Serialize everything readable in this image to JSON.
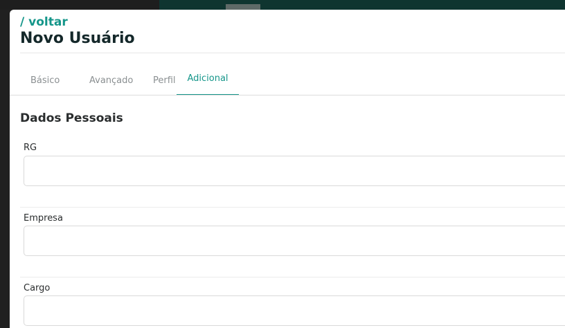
{
  "header": {
    "back_label": "/ voltar",
    "title": "Novo Usuário"
  },
  "tabs": [
    {
      "label": "Básico",
      "active": false
    },
    {
      "label": "Avançado",
      "active": false
    },
    {
      "label": "Perfil",
      "active": false
    },
    {
      "label": "Adicional",
      "active": true
    }
  ],
  "section": {
    "title": "Dados Pessoais"
  },
  "fields": [
    {
      "label": "RG",
      "value": ""
    },
    {
      "label": "Empresa",
      "value": ""
    },
    {
      "label": "Cargo",
      "value": ""
    }
  ],
  "colors": {
    "accent": "#15968a",
    "title": "#14282a",
    "backdrop": "#202020",
    "backdrop_teal": "#0f3530"
  }
}
